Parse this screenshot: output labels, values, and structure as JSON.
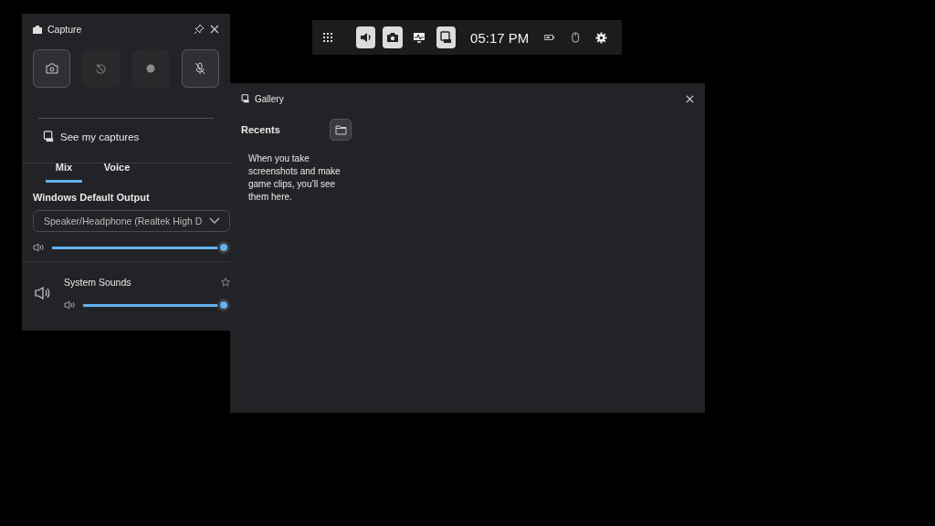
{
  "topbar": {
    "items": [
      {
        "kind": "widgets",
        "on": false
      },
      {
        "kind": "audio",
        "on": true
      },
      {
        "kind": "capture",
        "on": true
      },
      {
        "kind": "performance",
        "on": false
      },
      {
        "kind": "gallery",
        "on": true
      }
    ],
    "time": "05:17 PM",
    "status": [
      {
        "kind": "battery"
      },
      {
        "kind": "mouse"
      },
      {
        "kind": "settings"
      }
    ]
  },
  "capture": {
    "title": "Capture",
    "actions": [
      {
        "kind": "screenshot",
        "disabled": false
      },
      {
        "kind": "record-last",
        "disabled": true
      },
      {
        "kind": "record",
        "disabled": true
      },
      {
        "kind": "mic",
        "disabled": false
      }
    ],
    "link": "See my captures"
  },
  "audio": {
    "tabs": [
      {
        "label": "Mix",
        "selected": true
      },
      {
        "label": "Voice",
        "selected": false
      }
    ],
    "output_label": "Windows Default Output",
    "device": "Speaker/Headphone (Realtek High D",
    "master": {
      "level": 1
    },
    "apps": [
      {
        "name": "System Sounds",
        "level": 1
      }
    ]
  },
  "gallery": {
    "title": "Gallery",
    "heading": "Recents",
    "message": "When you take screenshots and make game clips, you’ll see them here."
  }
}
